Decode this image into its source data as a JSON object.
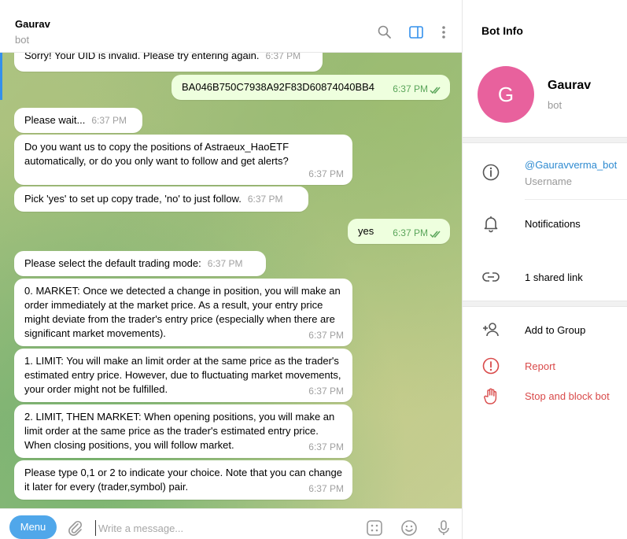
{
  "chat": {
    "title": "Gaurav",
    "subtitle": "bot",
    "messages": [
      {
        "dir": "in",
        "text": "Sorry! Your UID is invalid. Please try entering again.",
        "time": "6:37 PM"
      },
      {
        "dir": "out",
        "text": "BA046B750C7938A92F83D60874040BB4",
        "time": "6:37 PM"
      },
      {
        "dir": "in",
        "text": "Please wait...",
        "time": "6:37 PM"
      },
      {
        "dir": "in",
        "text": "Do you want us to copy the positions of Astraeux_HaoETF automatically, or do you only want to follow and get alerts?",
        "time": "6:37 PM"
      },
      {
        "dir": "in",
        "text": "Pick 'yes' to set up copy trade, 'no' to just follow.",
        "time": "6:37 PM"
      },
      {
        "dir": "out",
        "text": "yes",
        "time": "6:37 PM"
      },
      {
        "dir": "in",
        "text": "Please select the default trading mode:",
        "time": "6:37 PM"
      },
      {
        "dir": "in",
        "text": "0. MARKET: Once we detected a change in position, you will make an order immediately at the market price. As a result, your entry price might deviate from the trader's entry price (especially when there are significant market movements).",
        "time": "6:37 PM"
      },
      {
        "dir": "in",
        "text": "1. LIMIT: You will make an limit order at the same price as the trader's estimated entry price. However, due to fluctuating market movements, your order might not be fulfilled.",
        "time": "6:37 PM"
      },
      {
        "dir": "in",
        "text": "2. LIMIT, THEN MARKET: When opening positions, you will make an limit order at the same price as the trader's estimated entry price. When closing positions, you will follow market.",
        "time": "6:37 PM"
      },
      {
        "dir": "in",
        "text": "Please type 0,1 or 2 to indicate your choice. Note that you can change it later for every (trader,symbol) pair.",
        "time": "6:37 PM"
      }
    ],
    "composer": {
      "menu_label": "Menu",
      "placeholder": "Write a message..."
    }
  },
  "info": {
    "title": "Bot Info",
    "avatar_letter": "G",
    "avatar_color": "#e8619d",
    "name": "Gaurav",
    "subtitle": "bot",
    "username": "@Gauravverma_bot",
    "username_label": "Username",
    "notifications_label": "Notifications",
    "shared_link_label": "1 shared link",
    "add_to_group_label": "Add to Group",
    "report_label": "Report",
    "block_label": "Stop and block bot"
  },
  "colors": {
    "accent": "#50a7ea",
    "outgoing_bubble": "#eeffde",
    "danger": "#d94a4a",
    "link": "#2f8bd1"
  }
}
